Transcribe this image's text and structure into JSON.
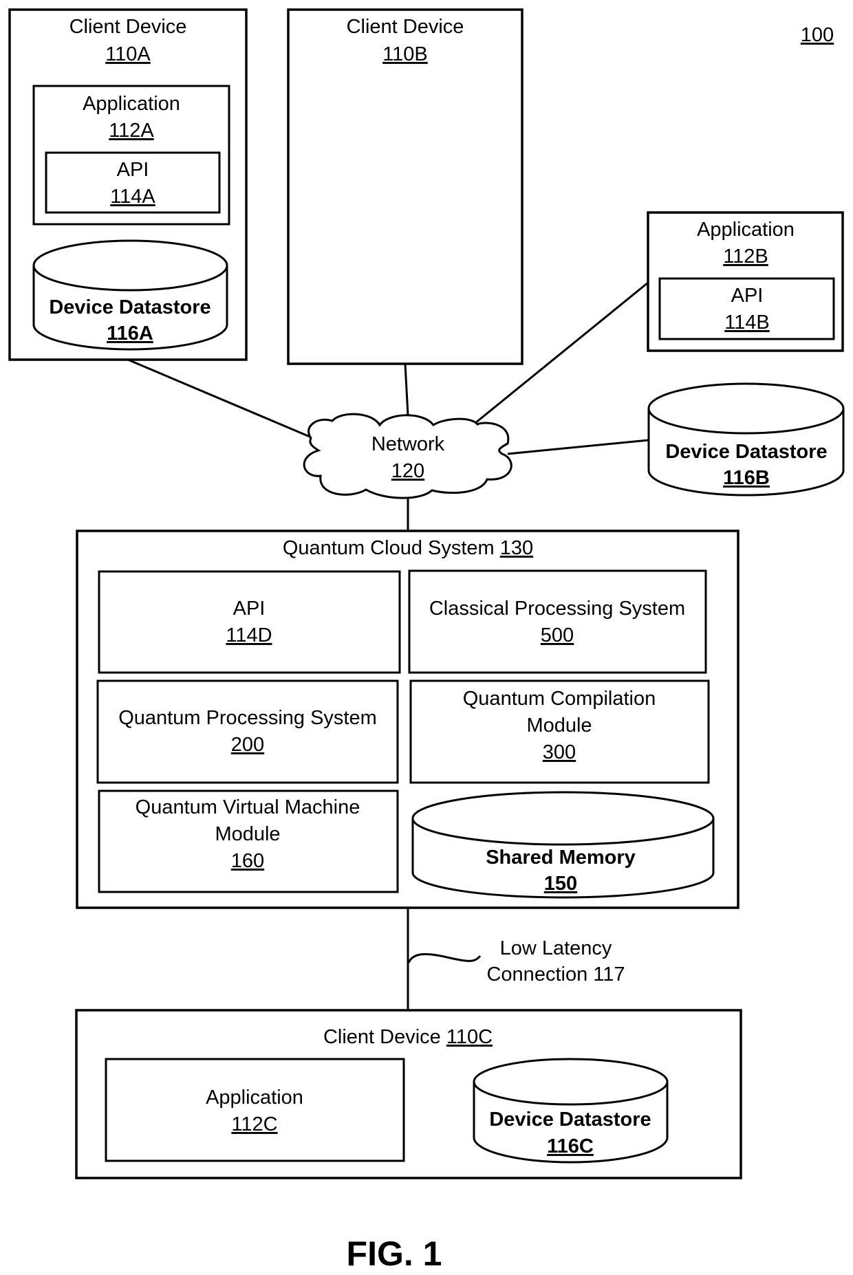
{
  "figure": {
    "system_ref": "100",
    "caption": "FIG. 1"
  },
  "client_a": {
    "label": "Client Device",
    "ref": "110A",
    "application": {
      "label": "Application",
      "ref": "112A"
    },
    "api": {
      "label": "API",
      "ref": "114A"
    },
    "datastore": {
      "label": "Device Datastore",
      "ref": "116A"
    }
  },
  "client_b": {
    "label": "Client Device",
    "ref": "110B",
    "application": {
      "label": "Application",
      "ref": "112B"
    },
    "api": {
      "label": "API",
      "ref": "114B"
    },
    "datastore": {
      "label": "Device Datastore",
      "ref": "116B"
    }
  },
  "network": {
    "label": "Network",
    "ref": "120"
  },
  "cloud_system": {
    "label": "Quantum Cloud System",
    "ref": "130",
    "api": {
      "label": "API",
      "ref": "114D"
    },
    "classical": {
      "label": "Classical Processing System",
      "ref": "500"
    },
    "quantum_processing": {
      "label": "Quantum Processing System",
      "ref": "200"
    },
    "compilation": {
      "line1": "Quantum Compilation",
      "line2": "Module",
      "ref": "300"
    },
    "qvm": {
      "line1": "Quantum Virtual Machine",
      "line2": "Module",
      "ref": "160"
    },
    "shared_memory": {
      "label": "Shared Memory",
      "ref": "150"
    }
  },
  "low_latency": {
    "line1": "Low Latency",
    "line2": "Connection 117"
  },
  "client_c": {
    "label": "Client Device",
    "ref": "110C",
    "application": {
      "label": "Application",
      "ref": "112C"
    },
    "datastore": {
      "label": "Device Datastore",
      "ref": "116C"
    }
  }
}
